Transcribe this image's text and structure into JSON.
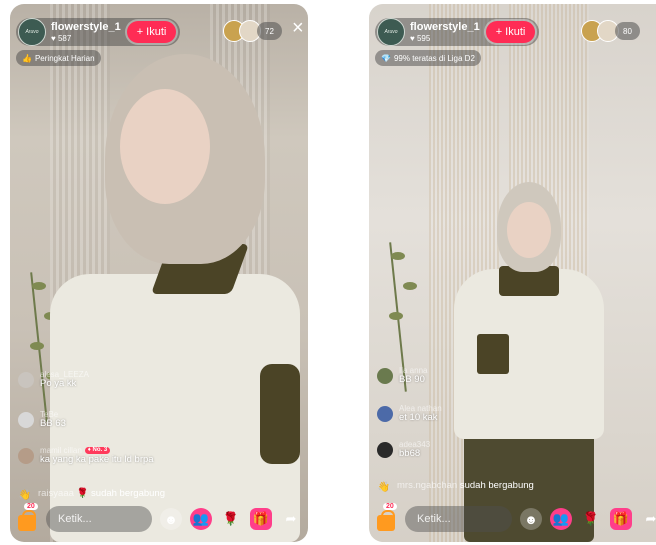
{
  "left": {
    "host": {
      "name": "flowerstyle_1",
      "likes": "587",
      "avatar_text": "Aruvo"
    },
    "follow_label": "+ Ikuti",
    "badge": {
      "icon": "👍",
      "text": "Peringkat Harian"
    },
    "viewer_count": "72",
    "close": "×",
    "chat": [
      {
        "user": "alesa_LEEZA",
        "msg": "Po ya kk",
        "avatar_color": "#c9c4be"
      },
      {
        "user": "TeBe",
        "msg": "BB 63",
        "avatar_color": "#d8d8d8"
      },
      {
        "user": "mamil cillan",
        "rank": "No. 3",
        "msg": "ka yang ka pake itu ld brpa",
        "avatar_color": "#b59c88"
      }
    ],
    "join": {
      "user": "raisyaaa",
      "text": "sudah bergabung"
    },
    "bag_count": "20",
    "input_placeholder": "Ketik..."
  },
  "right": {
    "host": {
      "name": "flowerstyle_1",
      "likes": "595",
      "avatar_text": "Aruvo"
    },
    "follow_label": "+ Ikuti",
    "badge": {
      "icon": "💎",
      "text": "99% teratas di Liga D2"
    },
    "viewer_count": "80",
    "chat": [
      {
        "user": "Ila anna",
        "msg": "BB 90",
        "avatar_color": "#6a7a4e"
      },
      {
        "user": "Alea nathan",
        "msg": "et 10 kak",
        "avatar_color": "#4c6aa8"
      },
      {
        "user": "adea343",
        "msg": "bb68",
        "avatar_color": "#2a2a2a"
      }
    ],
    "join": {
      "user": "mrs.ngabchan",
      "text": "sudah bergabung"
    },
    "bag_count": "20",
    "input_placeholder": "Ketik..."
  },
  "colors": {
    "follow": "#ff2c55",
    "bag": "#ff9a1f",
    "gift": "#ff3e8a",
    "share": "#ffffff"
  },
  "icons": [
    "like-icon",
    "smile-icon",
    "people-icon",
    "rose-icon",
    "gift-icon",
    "share-icon",
    "close-icon",
    "shopping-bag-icon"
  ]
}
